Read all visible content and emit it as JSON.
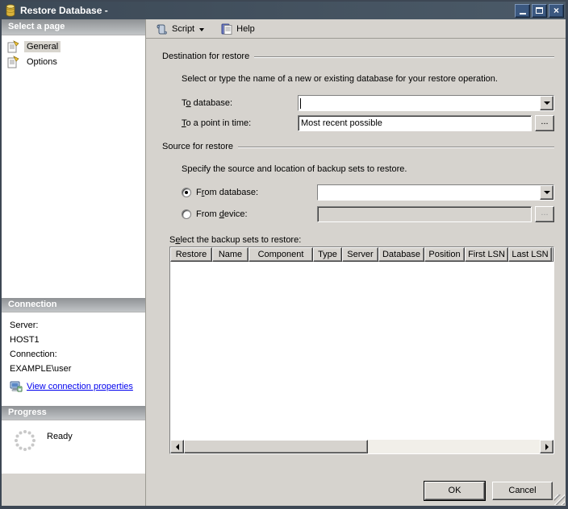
{
  "window": {
    "title": "Restore Database -",
    "controls": [
      "minimize",
      "maximize",
      "close"
    ],
    "close_glyph": "×"
  },
  "toolbar": {
    "script": "Script",
    "help": "Help"
  },
  "sidebar": {
    "select_page": {
      "header": "Select a page",
      "items": [
        {
          "label": "General",
          "selected": true
        },
        {
          "label": "Options",
          "selected": false
        }
      ]
    },
    "connection": {
      "header": "Connection",
      "server_label": "Server:",
      "server_value": "HOST1",
      "connection_label": "Connection:",
      "connection_value": "EXAMPLE\\user",
      "link": "View connection properties"
    },
    "progress": {
      "header": "Progress",
      "status": "Ready"
    }
  },
  "destination": {
    "caption": "Destination for restore",
    "description": "Select or type the name of a new or existing database for your restore operation.",
    "to_database": {
      "pre": "T",
      "accel": "o",
      "post": " database:",
      "value": ""
    },
    "to_point": {
      "pre": "",
      "accel": "T",
      "post": "o a point in time:",
      "value": "Most recent possible",
      "browse": "..."
    }
  },
  "source": {
    "caption": "Source for restore",
    "description": "Specify the source and location of backup sets to restore.",
    "from_database": {
      "pre": "F",
      "accel": "r",
      "post": "om database:",
      "value": ""
    },
    "from_device": {
      "pre": "From ",
      "accel": "d",
      "post": "evice:",
      "value": "",
      "browse": "..."
    },
    "backup_sets_label": {
      "pre": "S",
      "accel": "e",
      "post": "lect the backup sets to restore:"
    }
  },
  "table": {
    "columns": [
      "Restore",
      "Name",
      "Component",
      "Type",
      "Server",
      "Database",
      "Position",
      "First LSN",
      "Last LSN"
    ],
    "rows": []
  },
  "footer": {
    "ok": "OK",
    "cancel": "Cancel"
  },
  "colors": {
    "titlebar": "#43525f",
    "face": "#d6d3ce",
    "header_gradient_top": "#8f9295",
    "header_gradient_bottom": "#c2c5c7",
    "link": "#0000ee",
    "db_icon_gold": "#e8c44a"
  }
}
